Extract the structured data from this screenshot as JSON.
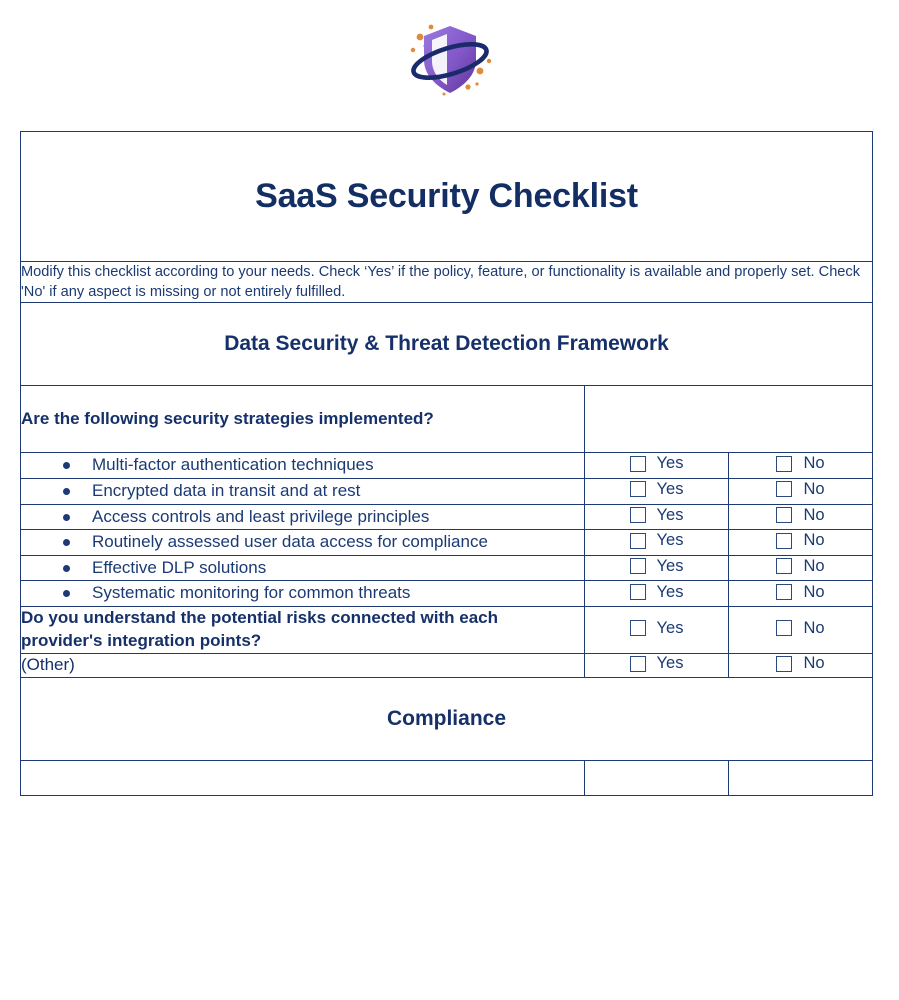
{
  "logo": {
    "name": "shield-orbit-logo",
    "shield_gradient_light": "#8a63d2",
    "shield_gradient_dark": "#6b3fa0",
    "orbit_color": "#1b2a6b",
    "dot_color": "#e08a3c"
  },
  "document": {
    "title": "SaaS Security Checklist",
    "instructions": "Modify this checklist according to your needs. Check ‘Yes’ if the policy, feature, or functionality is available and properly set. Check 'No' if any aspect is missing or not entirely fulfilled.",
    "accent_color": "#16306a",
    "border_color": "#1d3a74"
  },
  "checkbox": {
    "yes_label": "Yes",
    "no_label": "No"
  },
  "sections": [
    {
      "heading": "Data Security & Threat Detection Framework",
      "rows": [
        {
          "kind": "question-header",
          "text": "Are the following security strategies implemented?",
          "has_checkboxes": false
        },
        {
          "kind": "bullet",
          "text": "Multi-factor authentication techniques",
          "has_checkboxes": true
        },
        {
          "kind": "bullet",
          "text": "Encrypted data in transit and at rest",
          "has_checkboxes": true
        },
        {
          "kind": "bullet",
          "text": "Access controls and least privilege principles",
          "has_checkboxes": true
        },
        {
          "kind": "bullet",
          "text": "Routinely assessed user data access for compliance",
          "has_checkboxes": true
        },
        {
          "kind": "bullet",
          "text": "Effective DLP solutions",
          "has_checkboxes": true
        },
        {
          "kind": "bullet",
          "text": "Systematic monitoring for common threats",
          "has_checkboxes": true
        },
        {
          "kind": "question",
          "text": "Do you understand the potential risks connected with each provider's integration points?",
          "has_checkboxes": true
        },
        {
          "kind": "question",
          "text": "(Other)",
          "has_checkboxes": true
        }
      ]
    },
    {
      "heading": "Compliance",
      "rows": []
    }
  ]
}
